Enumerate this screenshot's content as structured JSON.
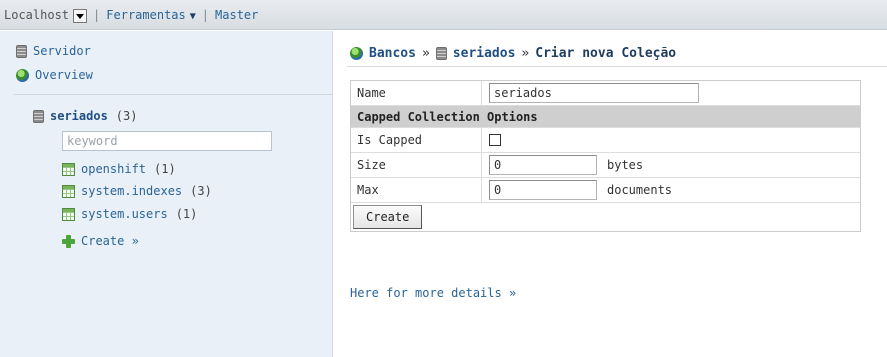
{
  "topbar": {
    "host": "Localhost",
    "tools": "Ferramentas",
    "master": "Master",
    "separator": "|"
  },
  "sidebar": {
    "server": "Servidor",
    "overview": "Overview",
    "database": {
      "name": "seriados",
      "count": "(3)"
    },
    "keyword_placeholder": "keyword",
    "collections": [
      {
        "name": "openshift",
        "count": "(1)"
      },
      {
        "name": "system.indexes",
        "count": "(3)"
      },
      {
        "name": "system.users",
        "count": "(1)"
      }
    ],
    "create": "Create »"
  },
  "breadcrumb": {
    "databases": "Bancos",
    "separator": "»",
    "db": "seriados",
    "current": "Criar nova Coleção"
  },
  "form": {
    "name_label": "Name",
    "name_value": "seriados",
    "section_title": "Capped Collection Options",
    "capped_label": "Is Capped",
    "size_label": "Size",
    "size_value": "0",
    "size_unit": "bytes",
    "max_label": "Max",
    "max_value": "0",
    "max_unit": "documents",
    "create_button": "Create"
  },
  "details_link": "Here for more details »",
  "colors": {
    "link": "#1f4f86",
    "sidebar_bg": "#eaf0f8",
    "topbar_bg": "#d8dde2",
    "section_header_bg": "#cfcfcf"
  },
  "icons": {
    "server": "server-icon",
    "overview": "globe-icon",
    "database": "database-icon",
    "collection": "table-icon",
    "create": "plus-icon"
  }
}
